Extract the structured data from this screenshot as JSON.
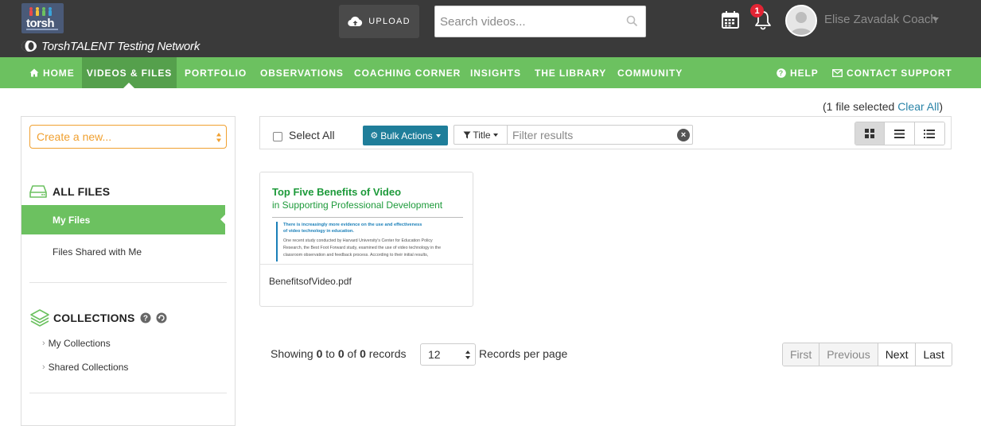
{
  "header": {
    "logo_text": "torsh",
    "network_name": "TorshTALENT Testing Network",
    "upload_label": "UPLOAD",
    "search_placeholder": "Search videos...",
    "notification_count": "1",
    "user_name": "Elise Zavadak Coach"
  },
  "nav": {
    "items": [
      {
        "label": "HOME",
        "icon": "home-icon"
      },
      {
        "label": "VIDEOS & FILES",
        "active": true
      },
      {
        "label": "PORTFOLIO"
      },
      {
        "label": "OBSERVATIONS"
      },
      {
        "label": "COACHING CORNER"
      },
      {
        "label": "INSIGHTS"
      },
      {
        "label": "THE LIBRARY"
      },
      {
        "label": "COMMUNITY"
      }
    ],
    "right": [
      {
        "label": "HELP",
        "icon": "question-circle-icon"
      },
      {
        "label": "CONTACT SUPPORT",
        "icon": "envelope-icon"
      }
    ]
  },
  "selection": {
    "text": "(1 file selected ",
    "clear_label": "Clear All",
    "close_paren": ")"
  },
  "sidebar": {
    "create_label": "Create a new...",
    "all_files_heading": "ALL FILES",
    "my_files_label": "My Files",
    "shared_label": "Files Shared with Me",
    "collections_heading": "COLLECTIONS",
    "collection_links": [
      "My Collections",
      "Shared Collections"
    ]
  },
  "toolbar": {
    "select_all_label": "Select All",
    "bulk_actions_label": "Bulk Actions",
    "filter_field": "Title",
    "filter_placeholder": "Filter results",
    "views": [
      "grid-view-icon",
      "list-view-icon",
      "detail-list-icon"
    ]
  },
  "files": [
    {
      "name": "BenefitsofVideo.pdf",
      "thumb_title1": "Top Five Benefits of Video",
      "thumb_title2": "in Supporting Professional Development",
      "thumb_lead1": "There is increasingly more evidence on the use and effectiveness",
      "thumb_lead2": "of video technology in education.",
      "thumb_body1": "One recent study conducted by Harvard University's Center for Education Policy",
      "thumb_body2": "Research, the Best Foot Forward study, examined the use of video technology in the",
      "thumb_body3": "classroom observation and feedback process. According to their initial results,"
    }
  ],
  "pagination": {
    "showing_prefix": "Showing ",
    "from": "0",
    "to_word": " to ",
    "to": "0",
    "of_word": " of ",
    "total": "0",
    "records_word": " records",
    "per_page_value": "12",
    "per_page_label": "Records per page",
    "buttons": [
      {
        "label": "First",
        "enabled": false
      },
      {
        "label": "Previous",
        "enabled": false
      },
      {
        "label": "Next",
        "enabled": true
      },
      {
        "label": "Last",
        "enabled": true
      }
    ]
  },
  "colors": {
    "topbar": "#3a3a3a",
    "nav_green": "#6cc160",
    "nav_active": "#55a04c",
    "accent_orange": "#f0a030",
    "bulk_blue": "#1f7e9a",
    "link_blue": "#2a84a8",
    "badge_red": "#e32434"
  }
}
